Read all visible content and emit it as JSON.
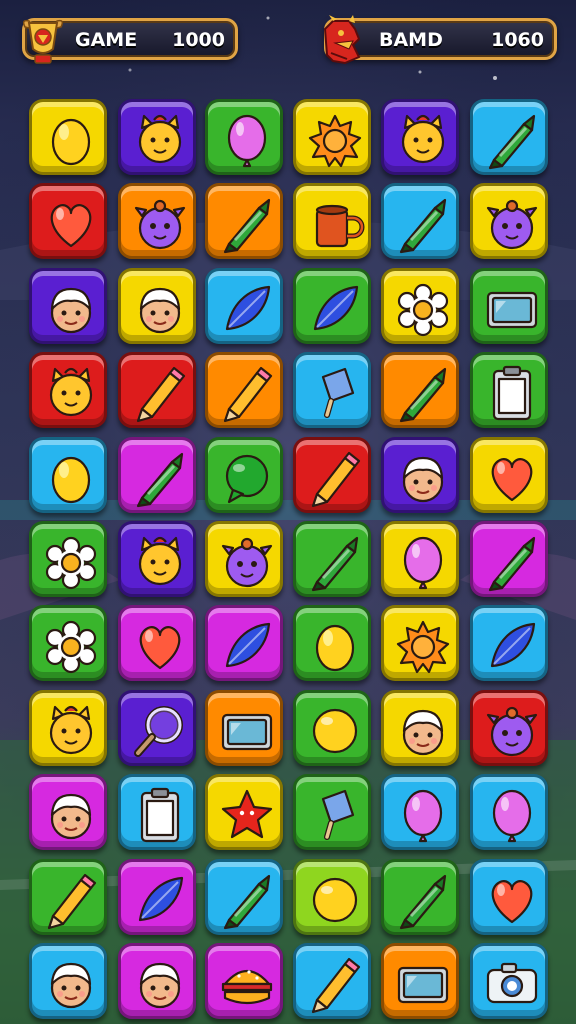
{
  "hud": {
    "left": {
      "label": "GAME",
      "value": "1000",
      "emblem": "trophy-emblem-icon"
    },
    "right": {
      "label": "BAMD",
      "value": "1060",
      "emblem": "dragon-emblem-icon"
    }
  },
  "colors": {
    "yellow": "#f5d800",
    "purple": "#5a1fd1",
    "green": "#39b52c",
    "orange": "#ff8a00",
    "cyan": "#27b5ef",
    "red": "#dd1c1c",
    "magenta": "#d629e0",
    "lime": "#8fd61f"
  },
  "board": {
    "rows": [
      [
        {
          "c": "yellow",
          "i": "lemon"
        },
        {
          "c": "purple",
          "i": "cat"
        },
        {
          "c": "green",
          "i": "balloon"
        },
        {
          "c": "yellow",
          "i": "sun"
        },
        {
          "c": "purple",
          "i": "cat"
        },
        {
          "c": "cyan",
          "i": "crayon"
        }
      ],
      [
        {
          "c": "red",
          "i": "heart"
        },
        {
          "c": "orange",
          "i": "alien"
        },
        {
          "c": "orange",
          "i": "crayon"
        },
        {
          "c": "yellow",
          "i": "mug"
        },
        {
          "c": "cyan",
          "i": "crayon"
        },
        {
          "c": "yellow",
          "i": "alien"
        }
      ],
      [
        {
          "c": "purple",
          "i": "face"
        },
        {
          "c": "yellow",
          "i": "face"
        },
        {
          "c": "cyan",
          "i": "leaf"
        },
        {
          "c": "green",
          "i": "leaf"
        },
        {
          "c": "yellow",
          "i": "flower"
        },
        {
          "c": "green",
          "i": "screen"
        }
      ],
      [
        {
          "c": "red",
          "i": "cat"
        },
        {
          "c": "red",
          "i": "pencil"
        },
        {
          "c": "orange",
          "i": "pencil"
        },
        {
          "c": "cyan",
          "i": "popsicle"
        },
        {
          "c": "orange",
          "i": "crayon"
        },
        {
          "c": "green",
          "i": "clipboard"
        }
      ],
      [
        {
          "c": "cyan",
          "i": "lemon"
        },
        {
          "c": "magenta",
          "i": "crayon"
        },
        {
          "c": "green",
          "i": "bubble"
        },
        {
          "c": "red",
          "i": "pencil"
        },
        {
          "c": "purple",
          "i": "face"
        },
        {
          "c": "yellow",
          "i": "heart"
        }
      ],
      [
        {
          "c": "green",
          "i": "flower"
        },
        {
          "c": "purple",
          "i": "cat"
        },
        {
          "c": "yellow",
          "i": "alien"
        },
        {
          "c": "green",
          "i": "crayon"
        },
        {
          "c": "yellow",
          "i": "balloon"
        },
        {
          "c": "magenta",
          "i": "crayon"
        }
      ],
      [
        {
          "c": "green",
          "i": "flower"
        },
        {
          "c": "magenta",
          "i": "heart"
        },
        {
          "c": "magenta",
          "i": "leaf"
        },
        {
          "c": "green",
          "i": "lemon"
        },
        {
          "c": "yellow",
          "i": "sun"
        },
        {
          "c": "cyan",
          "i": "leaf"
        }
      ],
      [
        {
          "c": "yellow",
          "i": "cat"
        },
        {
          "c": "purple",
          "i": "magnifier"
        },
        {
          "c": "orange",
          "i": "screen"
        },
        {
          "c": "green",
          "i": "ball"
        },
        {
          "c": "yellow",
          "i": "face"
        },
        {
          "c": "red",
          "i": "alien"
        }
      ],
      [
        {
          "c": "magenta",
          "i": "face"
        },
        {
          "c": "cyan",
          "i": "clipboard"
        },
        {
          "c": "yellow",
          "i": "star"
        },
        {
          "c": "green",
          "i": "popsicle"
        },
        {
          "c": "cyan",
          "i": "balloon"
        },
        {
          "c": "cyan",
          "i": "balloon"
        }
      ],
      [
        {
          "c": "green",
          "i": "pencil"
        },
        {
          "c": "magenta",
          "i": "leaf"
        },
        {
          "c": "cyan",
          "i": "crayon"
        },
        {
          "c": "lime",
          "i": "ball"
        },
        {
          "c": "green",
          "i": "crayon"
        },
        {
          "c": "cyan",
          "i": "heart"
        }
      ],
      [
        {
          "c": "cyan",
          "i": "face"
        },
        {
          "c": "magenta",
          "i": "face"
        },
        {
          "c": "magenta",
          "i": "burger"
        },
        {
          "c": "cyan",
          "i": "pencil"
        },
        {
          "c": "orange",
          "i": "screen"
        },
        {
          "c": "cyan",
          "i": "camera"
        }
      ]
    ]
  }
}
